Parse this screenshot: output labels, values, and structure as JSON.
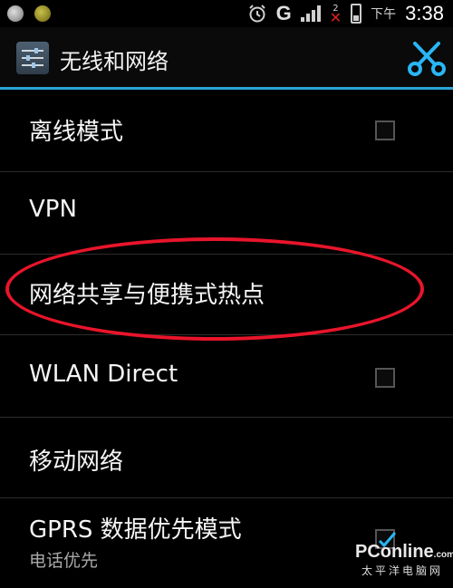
{
  "status_bar": {
    "network_label": "G",
    "sim_label": "2",
    "time_prefix": "下午",
    "time": "3:38"
  },
  "action_bar": {
    "title": "无线和网络",
    "app_icon": "settings-sliders-icon",
    "right_icon": "scissors-icon"
  },
  "settings": [
    {
      "label": "离线模式",
      "checkbox": true,
      "checked": false
    },
    {
      "label": "VPN"
    },
    {
      "label": "网络共享与便携式热点",
      "highlighted": true
    },
    {
      "label": "WLAN Direct",
      "checkbox": true,
      "checked": false
    },
    {
      "label": "移动网络"
    },
    {
      "label": "GPRS 数据优先模式",
      "summary": "电话优先",
      "checkbox": true,
      "checked": true
    }
  ],
  "watermark": {
    "brand": "PConline",
    "domain_suffix": ".com.cn",
    "chinese": "太平洋电脑网"
  },
  "colors": {
    "background": "#000000",
    "accent_line": "#2aa6d6",
    "highlight_ellipse": "#e8152b"
  }
}
